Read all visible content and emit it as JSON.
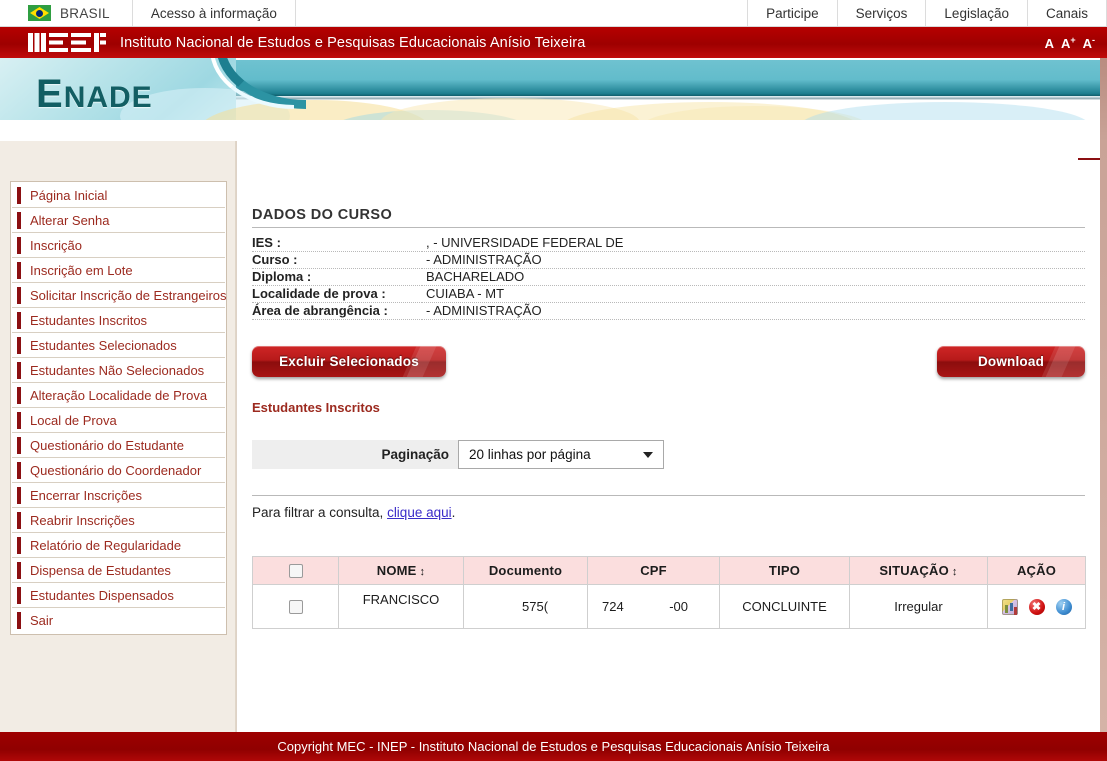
{
  "govbar": {
    "brasil_label": "BRASIL",
    "acesso_label": "Acesso à informação",
    "right_items": [
      "Participe",
      "Serviços",
      "Legislação",
      "Canais"
    ]
  },
  "inepbar": {
    "logo_text": "inep",
    "title": "Instituto Nacional de Estudos e Pesquisas Educacionais Anísio Teixeira",
    "font_normal": "A",
    "font_increase": "A",
    "font_increase_sup": "+",
    "font_decrease": "A",
    "font_decrease_sup": "-"
  },
  "banner": {
    "word_first": "E",
    "word_rest": "NADE"
  },
  "sidebar": {
    "items": [
      {
        "label": "Página Inicial"
      },
      {
        "label": "Alterar Senha"
      },
      {
        "label": "Inscrição"
      },
      {
        "label": "Inscrição em Lote"
      },
      {
        "label": "Solicitar Inscrição de Estrangeiros"
      },
      {
        "label": "Estudantes Inscritos"
      },
      {
        "label": "Estudantes Selecionados"
      },
      {
        "label": "Estudantes Não Selecionados"
      },
      {
        "label": "Alteração Localidade de Prova"
      },
      {
        "label": "Local de Prova"
      },
      {
        "label": "Questionário do Estudante"
      },
      {
        "label": "Questionário do Coordenador"
      },
      {
        "label": "Encerrar Inscrições"
      },
      {
        "label": "Reabrir Inscrições"
      },
      {
        "label": "Relatório de Regularidade"
      },
      {
        "label": "Dispensa de Estudantes"
      },
      {
        "label": "Estudantes Dispensados"
      },
      {
        "label": "Sair"
      }
    ]
  },
  "course": {
    "section_title": "DADOS DO CURSO",
    "rows": [
      {
        "key": "IES :",
        "value": ", - UNIVERSIDADE FEDERAL DE"
      },
      {
        "key": "Curso :",
        "value": "- ADMINISTRAÇÃO"
      },
      {
        "key": "Diploma :",
        "value": "BACHARELADO"
      },
      {
        "key": "Localidade de prova :",
        "value": "CUIABA - MT"
      },
      {
        "key": "Área de abrangência :",
        "value": "- ADMINISTRAÇÃO"
      }
    ]
  },
  "buttons": {
    "excluir_label": "Excluir Selecionados",
    "download_label": "Download"
  },
  "list": {
    "sub_title": "Estudantes Inscritos",
    "pagination_label": "Paginação",
    "pagination_value": "20 linhas por página",
    "filter_prefix": "Para filtrar a consulta, ",
    "filter_link": "clique aqui",
    "filter_suffix": "."
  },
  "table": {
    "columns": [
      {
        "label": "",
        "sortable": false
      },
      {
        "label": "NOME",
        "sortable": true
      },
      {
        "label": "Documento",
        "sortable": false
      },
      {
        "label": "CPF",
        "sortable": false
      },
      {
        "label": "TIPO",
        "sortable": false
      },
      {
        "label": "SITUAÇÃO",
        "sortable": true
      },
      {
        "label": "AÇÃO",
        "sortable": false
      }
    ],
    "sort_glyph": "↕",
    "rows": [
      {
        "nome": "FRANCISCO",
        "documento": "575(",
        "cpf_left": "724",
        "cpf_right": "-00",
        "tipo": "CONCLUINTE",
        "situacao": "Irregular",
        "action_icons": [
          "report-icon",
          "delete-icon",
          "info-icon"
        ],
        "delete_glyph": "✖",
        "info_glyph": "i"
      }
    ]
  },
  "footer": {
    "text": "Copyright MEC - INEP - Instituto Nacional de Estudos e Pesquisas Educacionais Anísio Teixeira"
  },
  "colors": {
    "brand_red": "#9e0000",
    "menu_text": "#9c2a1f",
    "banner_teal": "#62bccb",
    "link_blue": "#3b2cc9",
    "table_header_pink": "#fbdede"
  }
}
